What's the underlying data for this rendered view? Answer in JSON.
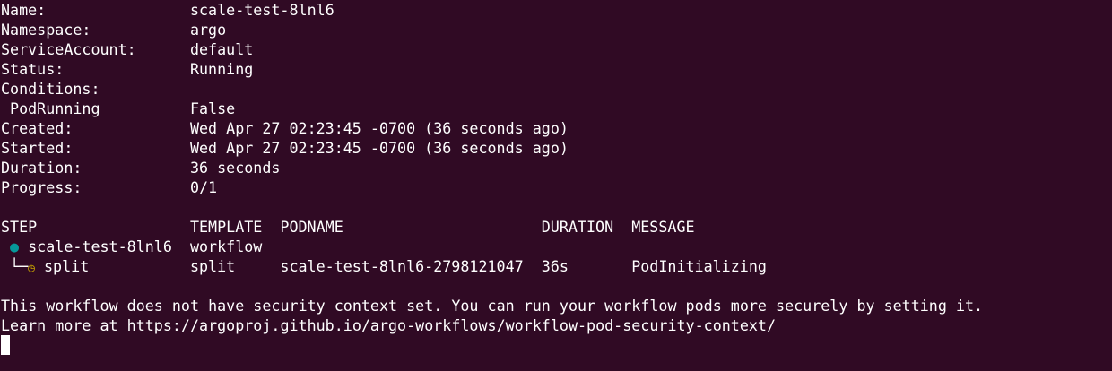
{
  "details": [
    {
      "label": "Name:",
      "value": "scale-test-8lnl6"
    },
    {
      "label": "Namespace:",
      "value": "argo"
    },
    {
      "label": "ServiceAccount:",
      "value": "default"
    },
    {
      "label": "Status:",
      "value": "Running"
    },
    {
      "label": "Conditions:",
      "value": ""
    },
    {
      "label": " PodRunning",
      "value": "False"
    },
    {
      "label": "Created:",
      "value": "Wed Apr 27 02:23:45 -0700 (36 seconds ago)"
    },
    {
      "label": "Started:",
      "value": "Wed Apr 27 02:23:45 -0700 (36 seconds ago)"
    },
    {
      "label": "Duration:",
      "value": "36 seconds"
    },
    {
      "label": "Progress:",
      "value": "0/1"
    }
  ],
  "table": {
    "headers": [
      "STEP",
      "TEMPLATE",
      "PODNAME",
      "DURATION",
      "MESSAGE"
    ],
    "rows": [
      {
        "prefix": " ",
        "icon": "●",
        "step": "scale-test-8lnl6",
        "template": "workflow",
        "podname": "",
        "duration": "",
        "message": ""
      },
      {
        "prefix": " └─",
        "icon": "◷",
        "step": "split",
        "template": "split",
        "podname": "scale-test-8lnl6-2798121047",
        "duration": "36s",
        "message": "PodInitializing"
      }
    ]
  },
  "notice": [
    "This workflow does not have security context set. You can run your workflow pods more securely by setting it.",
    "Learn more at https://argoproj.github.io/argo-workflows/workflow-pod-security-context/"
  ],
  "colors": {
    "background": "#300a24",
    "running": "#06989a",
    "pending": "#c4a000"
  }
}
